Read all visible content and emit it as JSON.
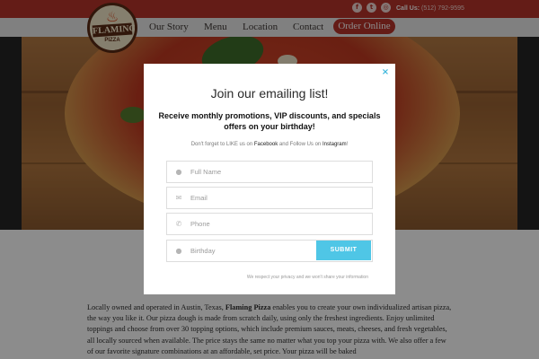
{
  "header": {
    "social_icons": [
      "facebook-icon",
      "twitter-icon",
      "instagram-icon"
    ],
    "call_label": "Call Us:",
    "phone": "(512) 792-9595",
    "logo_text": "FLAMING",
    "logo_sub": "PIZZA",
    "nav": [
      {
        "label": "Our Story"
      },
      {
        "label": "Menu"
      },
      {
        "label": "Location"
      },
      {
        "label": "Contact"
      }
    ],
    "order_label": "Order Online"
  },
  "colors": {
    "brand_red": "#b7332a",
    "accent_blue": "#4fc6e6"
  },
  "modal": {
    "title": "Join our emailing list!",
    "subtitle": "Receive monthly promotions, VIP discounts, and specials offers on your birthday!",
    "note_before": "Don't forget to LIKE us on ",
    "note_facebook": "Facebook",
    "note_middle": " and Follow Us on ",
    "note_instagram": "Instagram",
    "note_end": "!",
    "fields": {
      "name": {
        "placeholder": "Full Name",
        "value": ""
      },
      "email": {
        "placeholder": "Email",
        "value": ""
      },
      "phone": {
        "placeholder": "Phone",
        "value": ""
      },
      "birthday": {
        "placeholder": "Birthday",
        "value": ""
      }
    },
    "submit_label": "SUBMIT",
    "privacy": "We respect your privacy and we won't share your information",
    "close_label": "×"
  },
  "story": {
    "before": "Locally owned and operated in Austin, Texas, ",
    "brand": "Flaming Pizza",
    "after": " enables you to create your own individualized artisan pizza, the way you like it. Our pizza dough is made from scratch daily, using only the freshest ingredients. Enjoy unlimited toppings and choose from over 30 topping options, which include premium sauces, meats, cheeses, and fresh vegetables, all locally sourced when available. The price stays the same no matter what you top your pizza with. We also offer a few of our favorite signature combinations at an affordable, set price. Your pizza will be baked"
  }
}
